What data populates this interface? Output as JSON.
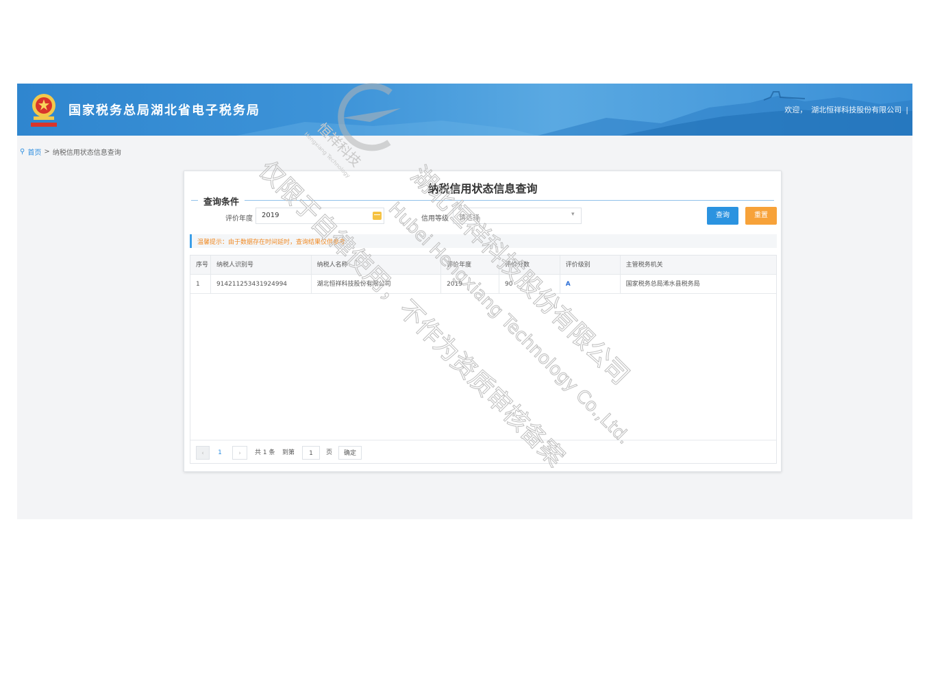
{
  "header": {
    "site_title": "国家税务总局湖北省电子税务局",
    "welcome_label": "欢迎，",
    "company_name": "湖北恒祥科技股份有限公司",
    "separator": "|"
  },
  "breadcrumb": {
    "home": "首页",
    "arrow": ">",
    "current": "纳税信用状态信息查询"
  },
  "page": {
    "title": "纳税信用状态信息查询",
    "legend": "查询条件"
  },
  "filters": {
    "year_label": "评价年度",
    "year_value": "2019",
    "level_label": "信用等级",
    "level_placeholder": "请选择"
  },
  "buttons": {
    "query": "查询",
    "reset": "重置"
  },
  "tip": "温馨提示：由于数据存在时间延时，查询结果仅供参考",
  "table": {
    "columns": [
      "序号",
      "纳税人识别号",
      "纳税人名称",
      "评价年度",
      "评价分数",
      "评价级别",
      "主管税务机关"
    ],
    "rows": [
      [
        "1",
        "914211253431924994",
        "湖北恒祥科技股份有限公司",
        "2019",
        "90",
        "A",
        "国家税务总局浠水县税务局"
      ]
    ]
  },
  "pager": {
    "prev": "‹",
    "current_page": "1",
    "next": "›",
    "total": "共 1 条",
    "goto_label": "到第",
    "goto_value": "1",
    "page_unit": "页",
    "confirm": "确定"
  },
  "watermark": {
    "logo_text": "恒祥科技",
    "logo_sub": "Hengxiang Technology",
    "line1": "湖北恒祥科技股份有限公司",
    "line2": "Hubei Hengxiang Technology Co.,Ltd.",
    "line3": "仅限于自律使用，不作为资质审核备案"
  },
  "colors": {
    "banner": "#3a8fd6",
    "accent": "#2b93e0",
    "reset": "#f7a239",
    "tip_text": "#f08a24"
  }
}
